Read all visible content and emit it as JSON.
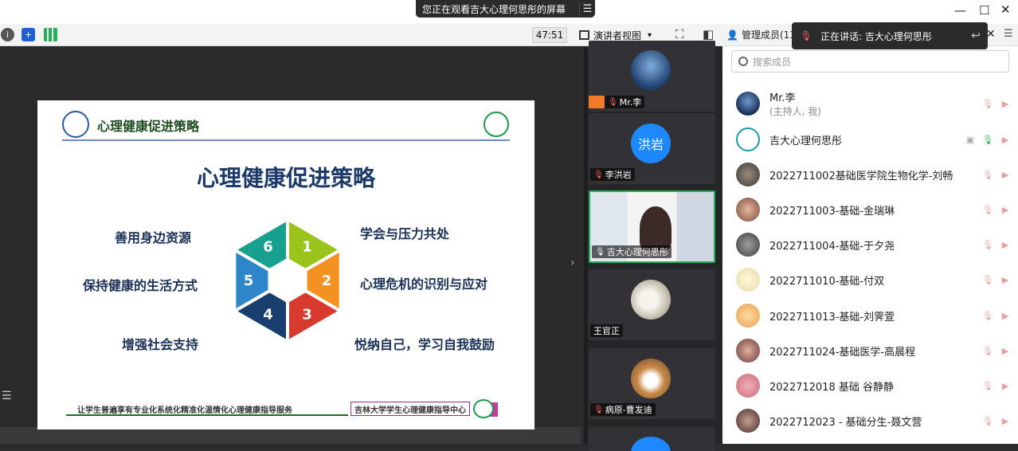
{
  "window": {
    "share_banner": "您正在观看吉大心理何思彤的屏幕",
    "banner_menu_icon": "hamburger-icon",
    "minimize_icon": "minimize-icon",
    "maximize_icon": "maximize-icon",
    "close_icon": "close-icon"
  },
  "toolbar": {
    "timer": "47:51",
    "view_label": "演讲者视图",
    "view_caret": "▾"
  },
  "slide": {
    "header_title": "心理健康促进策略",
    "main_title": "心理健康促进策略",
    "labels": {
      "l1": "善用身边资源",
      "l2": "保持健康的生活方式",
      "l3": "增强社会支持",
      "r1": "学会与压力共处",
      "r2": "心理危机的识别与应对",
      "r3": "悦纳自己，学习自我鼓励"
    },
    "segments": [
      {
        "num": "1",
        "color": "#9ac41c"
      },
      {
        "num": "2",
        "color": "#f39220"
      },
      {
        "num": "3",
        "color": "#d93a2e"
      },
      {
        "num": "4",
        "color": "#173e6c"
      },
      {
        "num": "5",
        "color": "#2e86c8"
      },
      {
        "num": "6",
        "color": "#17a08d"
      }
    ],
    "footer_left": "让学生普遍享有专业化系统化精准化温情化心理健康指导服务",
    "footer_right": "吉林大学学生心理健康指导中心"
  },
  "video_tiles": [
    {
      "name": "Mr.李"
    },
    {
      "name": "李洪岩",
      "avatar_text": "洪岩"
    },
    {
      "name": "吉大心理何思彤"
    },
    {
      "name": "王官正"
    },
    {
      "name": "病原-曹发迪"
    }
  ],
  "sidebar": {
    "header_label": "管理成员(13)",
    "speaking_label": "正在讲话: 吉大心理何思彤",
    "search_placeholder": "搜索成员",
    "members": [
      {
        "name": "Mr.李",
        "role": "(主持人, 我)"
      },
      {
        "name": "吉大心理何思彤",
        "role": ""
      },
      {
        "name": "2022711002基础医学院生物化学-刘畅",
        "role": ""
      },
      {
        "name": "2022711003-基础-金瑞琳",
        "role": ""
      },
      {
        "name": "2022711004-基础-于夕尧",
        "role": ""
      },
      {
        "name": "2022711010-基础-付双",
        "role": ""
      },
      {
        "name": "2022711013-基础-刘霁萱",
        "role": ""
      },
      {
        "name": "2022711024-基础医学-高晨程",
        "role": ""
      },
      {
        "name": "2022712018 基础 谷静静",
        "role": ""
      },
      {
        "name": "2022712023 - 基础分生-聂文营",
        "role": ""
      }
    ]
  },
  "colors": {
    "accent_green": "#22b05a",
    "muted_red": "#ff6262",
    "avatar_blue": "#1e88ff"
  }
}
